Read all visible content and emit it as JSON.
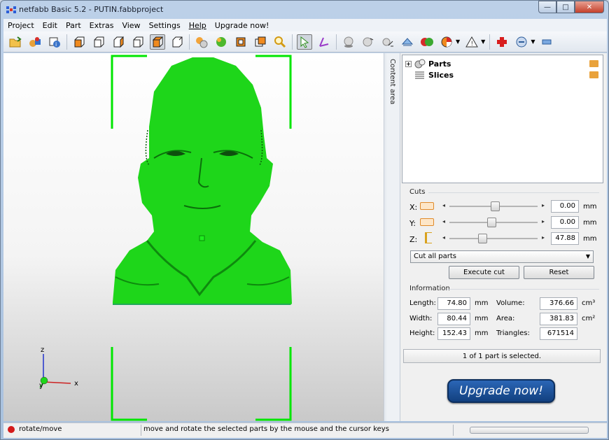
{
  "title": "netfabb Basic 5.2 - PUTIN.fabbproject",
  "window_buttons": {
    "minimize": "—",
    "maximize": "□",
    "close": "✕"
  },
  "menu": [
    "Project",
    "Edit",
    "Part",
    "Extras",
    "View",
    "Settings",
    "Help",
    "Upgrade now!"
  ],
  "toolbar_icons": [
    "open-folder-icon",
    "add-part-icon",
    "part-info-icon",
    "view-front-icon",
    "view-back-icon",
    "view-left-icon",
    "view-right-icon",
    "view-top-icon",
    "view-bottom-icon",
    "repair-icon",
    "repair-sphere-icon",
    "shell-icon",
    "scale-icon",
    "zoom-icon",
    "select-arrow-icon",
    "measure-icon",
    "sphere-icon",
    "move-sphere-icon",
    "move-parts-icon",
    "rotate-icon",
    "boolean-icon",
    "pie-icon",
    "warning-icon",
    "red-cross-icon",
    "layers-icon",
    "ruler-icon"
  ],
  "viewport": {
    "axis_z": "z",
    "axis_x": "x",
    "axis_y": "y",
    "model_color": "#1ed61a"
  },
  "side_tab": "Content area",
  "tree": {
    "parts_label": "Parts",
    "slices_label": "Slices"
  },
  "cuts": {
    "heading": "Cuts",
    "x_label": "X:",
    "y_label": "Y:",
    "z_label": "Z:",
    "x_value": "0.00",
    "y_value": "0.00",
    "z_value": "47.88",
    "unit": "mm",
    "x_slider": 0.52,
    "y_slider": 0.48,
    "z_slider": 0.36,
    "mode_select": "Cut all parts",
    "execute_label": "Execute cut",
    "reset_label": "Reset"
  },
  "information": {
    "heading": "Information",
    "length_label": "Length:",
    "length_value": "74.80",
    "width_label": "Width:",
    "width_value": "80.44",
    "height_label": "Height:",
    "height_value": "152.43",
    "mm": "mm",
    "volume_label": "Volume:",
    "volume_value": "376.66",
    "volume_unit": "cm³",
    "area_label": "Area:",
    "area_value": "381.83",
    "area_unit": "cm²",
    "triangles_label": "Triangles:",
    "triangles_value": "671514"
  },
  "selection_status": "1 of 1 part is selected.",
  "upgrade_label": "Upgrade now!",
  "statusbar": {
    "mode": "rotate/move",
    "message": "move and rotate the selected parts by the mouse and the cursor keys"
  }
}
